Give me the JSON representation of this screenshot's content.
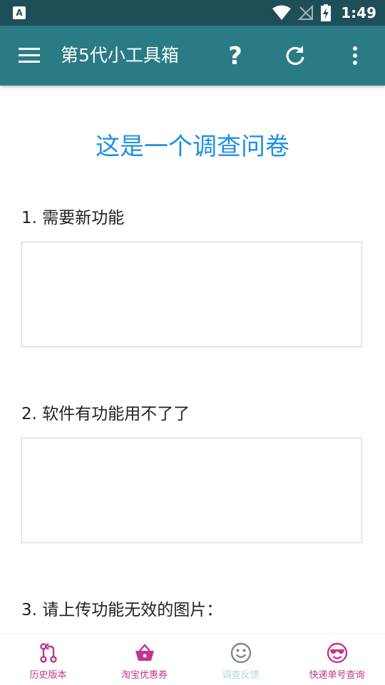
{
  "status_bar": {
    "time": "1:49",
    "icons": [
      "notification-a-icon",
      "wifi-icon",
      "no-signal-icon",
      "battery-charging-icon"
    ]
  },
  "app_bar": {
    "title": "第5代小工具箱",
    "icons": [
      "menu-icon",
      "help-icon",
      "refresh-icon",
      "more-vert-icon"
    ]
  },
  "survey": {
    "title": "这是一个调查问卷",
    "questions": [
      {
        "label": "1. 需要新功能",
        "value": ""
      },
      {
        "label": "2. 软件有功能用不了了",
        "value": ""
      },
      {
        "label": "3. 请上传功能无效的图片：",
        "value": ""
      }
    ]
  },
  "bottom_nav": {
    "items": [
      {
        "label": "历史版本",
        "icon": "history-branch-icon",
        "color": "#c2368c"
      },
      {
        "label": "淘宝优惠券",
        "icon": "basket-icon",
        "color": "#c2368c"
      },
      {
        "label": "调查反馈",
        "icon": "smiley-icon",
        "color": "#7f8a8c",
        "selected": true
      },
      {
        "label": "快递单号查询",
        "icon": "sunglasses-face-icon",
        "color": "#c2368c"
      }
    ]
  },
  "colors": {
    "status_bar": "#1e4f59",
    "app_bar": "#2a7b85",
    "survey_title": "#1e90e6",
    "nav_accent": "#c2368c",
    "nav_selected_label": "#a8d8d8"
  }
}
